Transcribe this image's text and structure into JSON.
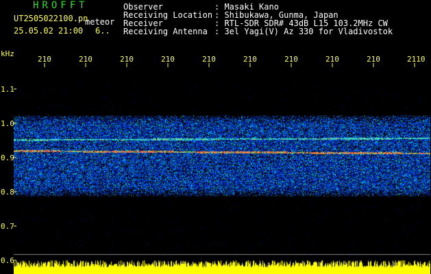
{
  "header": {
    "app_title": "HROFFT",
    "filename": "UT2505022100.pn",
    "meteor_label": "meteor",
    "datetime": "25.05.02 21:00",
    "count": "6..",
    "meta": [
      {
        "label": "Observer",
        "value": ": Masaki Kano"
      },
      {
        "label": "Receiving Location",
        "value": ": Shibukawa, Gunma, Japan"
      },
      {
        "label": "Receiver",
        "value": ": RTL-SDR SDR# 43dB L15 103.2MHz CW"
      },
      {
        "label": "Receiving Antenna",
        "value": ": 3el Yagi(V) Az 330 for Vladivostok"
      }
    ]
  },
  "axis": {
    "y_unit": "kHz",
    "y_ticks": [
      "1.1",
      "1.0",
      "0.9",
      "0.8",
      "0.7",
      "0.6"
    ],
    "x_ticks": [
      "210",
      "210",
      "210",
      "210",
      "210",
      "210",
      "210",
      "210",
      "210",
      "2110"
    ]
  },
  "colors": {
    "axis_text": "#ffff66",
    "title": "#33dd33",
    "signal_band": "#1a4cff",
    "signal_line": "#ff3333",
    "noise_bar": "#ffff00"
  }
}
